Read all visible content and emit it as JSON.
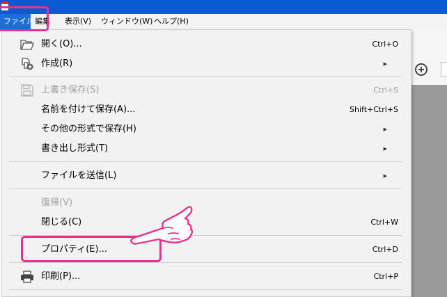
{
  "menubar": {
    "items": [
      {
        "label": "ファイル"
      },
      {
        "label": "編集"
      },
      {
        "label": "表示(V)"
      },
      {
        "label": "ウィンドウ(W)"
      },
      {
        "label": "ヘルプ(H)"
      }
    ]
  },
  "file_menu": {
    "open": {
      "label": "開く(O)...",
      "shortcut": "Ctrl+O"
    },
    "create": {
      "label": "作成(R)"
    },
    "save": {
      "label": "上書き保存(S)",
      "shortcut": "Ctrl+S"
    },
    "save_as": {
      "label": "名前を付けて保存(A)...",
      "shortcut": "Shift+Ctrl+S"
    },
    "save_other": {
      "label": "その他の形式で保存(H)"
    },
    "export": {
      "label": "書き出し形式(T)"
    },
    "send_file": {
      "label": "ファイルを送信(L)"
    },
    "revert": {
      "label": "復帰(V)"
    },
    "close": {
      "label": "閉じる(C)",
      "shortcut": "Ctrl+W"
    },
    "properties": {
      "label": "プロパティ(E)...",
      "shortcut": "Ctrl+D"
    },
    "print": {
      "label": "印刷(P)...",
      "shortcut": "Ctrl+P"
    }
  },
  "colors": {
    "highlight": "#e5318f",
    "title_bar": "#0a5bd1",
    "selected_menu": "#1f6ed4"
  },
  "icons": [
    "folder-open-icon",
    "create-document-icon",
    "save-disk-icon",
    "printer-icon",
    "pointing-hand-icon"
  ]
}
